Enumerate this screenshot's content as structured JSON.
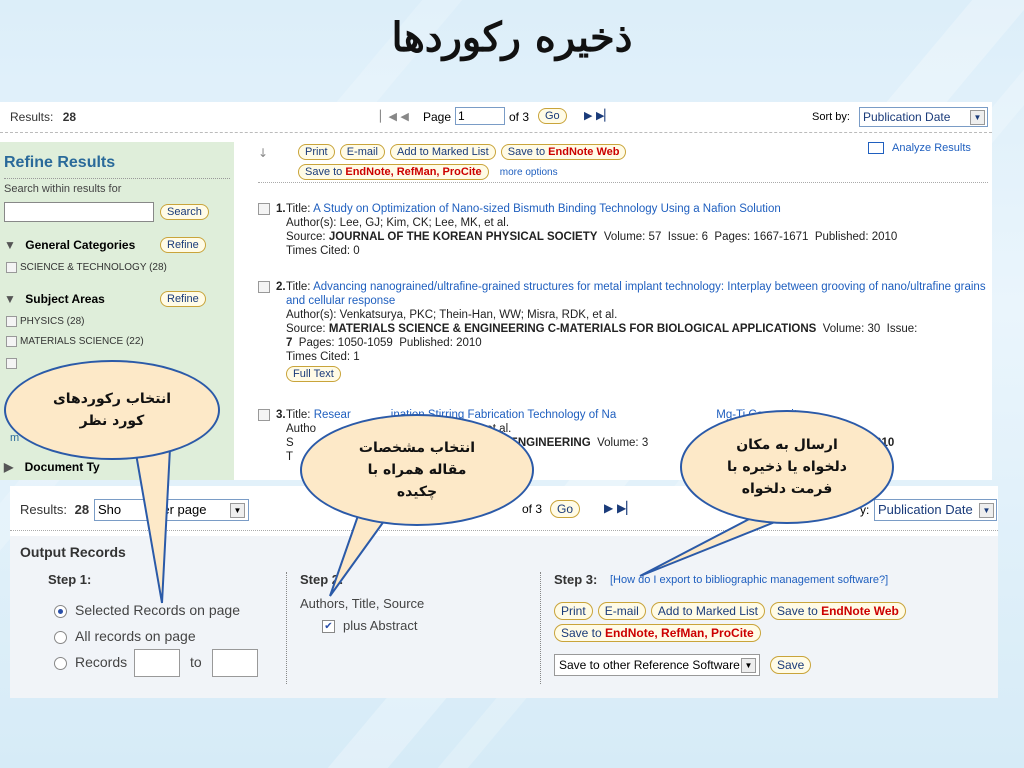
{
  "title": "ذخیره رکوردها",
  "top": {
    "results_label": "Results:",
    "results_count": "28",
    "page_label": "Page",
    "page_value": "1",
    "of_label": "of 3",
    "go": "Go",
    "sort_label": "Sort by:",
    "sort_value": "Publication Date",
    "analyze": "Analyze Results",
    "actions": {
      "print": "Print",
      "email": "E-mail",
      "marked": "Add to Marked List",
      "save_to": "Save to",
      "endnote_web": "EndNote Web",
      "save_endnote": "Save to",
      "endnote_refman": "EndNote, RefMan, ProCite",
      "more": "more options"
    }
  },
  "refine": {
    "heading": "Refine Results",
    "search_label": "Search within results for",
    "search_button": "Search",
    "general": "General Categories",
    "refine_button": "Refine",
    "sci_tech": "SCIENCE & TECHNOLOGY (28)",
    "subject": "Subject Areas",
    "physics": "PHYSICS (28)",
    "materials": "MATERIALS SCIENCE (22)",
    "doc_type": "Document Ty",
    "m_frag": "m"
  },
  "records": [
    {
      "num": "1.",
      "title_prefix": "Title:",
      "title": "A Study on Optimization of Nano-sized Bismuth Binding Technology Using a Nafion Solution",
      "authors": "Author(s): Lee, GJ; Kim, CK; Lee, MK, et al.",
      "source_label": "Source:",
      "source": "JOURNAL OF THE KOREAN PHYSICAL SOCIETY",
      "volume": "Volume: 57",
      "issue": "Issue: 6",
      "pages": "Pages: 1667-1671",
      "published": "Published: 2010",
      "cited": "Times Cited: 0"
    },
    {
      "num": "2.",
      "title_prefix": "Title:",
      "title": "Advancing nanograined/ultrafine-grained structures for metal implant technology: Interplay between grooving of nano/ultrafine grains and cellular response",
      "authors": "Author(s): Venkatsurya, PKC; Thein-Han, WW; Misra, RDK, et al.",
      "source_label": "Source:",
      "source": "MATERIALS SCIENCE & ENGINEERING C-MATERIALS FOR BIOLOGICAL APPLICATIONS",
      "volume": "Volume: 30",
      "issue": "Issue:",
      "issue_cont": "7",
      "pages": "Pages: 1050-1059",
      "published": "Published: 2010",
      "cited": "Times Cited: 1",
      "fulltext": "Full Text"
    },
    {
      "num": "3.",
      "title_prefix": "Title:",
      "title_a": "Resear",
      "title_b": "ination Stirring Fabrication Technology of Na",
      "title_c": "Mg-Ti Composites",
      "authors_frag": "Autho",
      "authors_frag2": "G, et al.",
      "source_frag": "S",
      "source_frag2": "D ENGINEERING",
      "volume": "Volume: 3",
      "published_frag": "ed: 2010",
      "t_frag": "T"
    }
  ],
  "bottom": {
    "results_label": "Results:",
    "results_count": "28",
    "show_frag": "Sho",
    "per_page": "per page",
    "of_label": "of 3",
    "go": "Go",
    "sort_frag": "y:",
    "sort_value": "Publication Date",
    "output_heading": "Output Records",
    "step1": "Step 1:",
    "opt_selected": "Selected Records on page",
    "opt_all": "All records on page",
    "opt_records": "Records",
    "to": "to",
    "step2": "Step 2:",
    "fields": "Authors, Title, Source",
    "plus_abstract": "plus Abstract",
    "step3": "Step 3:",
    "howto": "[How do I export to bibliographic management software?]",
    "print": "Print",
    "email": "E-mail",
    "marked": "Add to Marked List",
    "save_to": "Save to",
    "endnote_web": "EndNote Web",
    "endnote_refman": "EndNote, RefMan, ProCite",
    "other_ref": "Save to other Reference Software",
    "save": "Save"
  },
  "callouts": {
    "left": "انتخاب رکوردهای کورد نظر",
    "middle": "انتخاب مشخصات مقاله همراه با چکیده",
    "right": "ارسال به مکان دلخواه یا ذخیره با فرمت دلخواه"
  }
}
